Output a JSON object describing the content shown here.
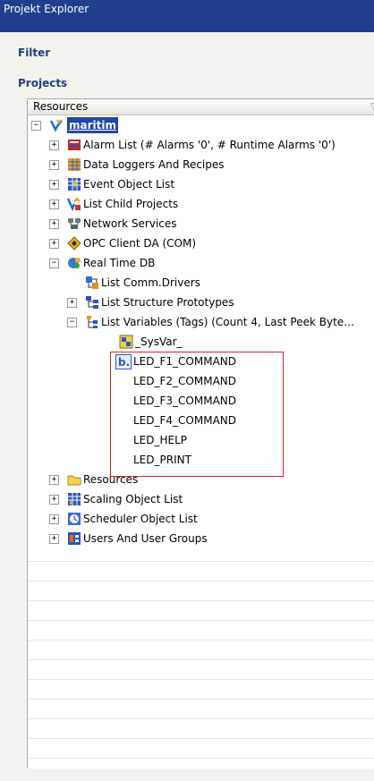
{
  "window": {
    "title": "Projekt Explorer"
  },
  "sections": {
    "filter": "Filter",
    "projects": "Projects"
  },
  "tree": {
    "column_header": "Resources",
    "root": "maritim",
    "items": [
      {
        "label": "Alarm List (# Alarms '0', # Runtime Alarms '0')",
        "icon": "alarm-list-icon",
        "expander": "+"
      },
      {
        "label": "Data Loggers And Recipes",
        "icon": "data-loggers-icon",
        "expander": "+"
      },
      {
        "label": "Event Object List",
        "icon": "event-list-icon",
        "expander": "+"
      },
      {
        "label": "List Child Projects",
        "icon": "child-projects-icon",
        "expander": "+"
      },
      {
        "label": "Network Services",
        "icon": "network-icon",
        "expander": "+"
      },
      {
        "label": "OPC Client DA (COM)",
        "icon": "opc-icon",
        "expander": "+"
      },
      {
        "label": "Real Time DB",
        "icon": "realtime-db-icon",
        "expander": "−"
      },
      {
        "label": "List Comm.Drivers",
        "icon": "comm-drivers-icon"
      },
      {
        "label": "List Structure Prototypes",
        "icon": "structure-icon",
        "expander": "+"
      },
      {
        "label": "List Variables (Tags) (Count 4, Last Peek Byte…",
        "icon": "variables-icon",
        "expander": "−"
      },
      {
        "label": "_SysVar_",
        "icon": "sysvar-icon"
      },
      {
        "label": "LED_F1_COMMAND",
        "icon": "bit-variable-icon"
      },
      {
        "label": "LED_F2_COMMAND"
      },
      {
        "label": "LED_F3_COMMAND"
      },
      {
        "label": "LED_F4_COMMAND"
      },
      {
        "label": "LED_HELP"
      },
      {
        "label": "LED_PRINT"
      },
      {
        "label": "Resources",
        "icon": "folder-icon",
        "expander": "+"
      },
      {
        "label": "Scaling Object List",
        "icon": "scaling-icon",
        "expander": "+"
      },
      {
        "label": "Scheduler Object List",
        "icon": "scheduler-icon",
        "expander": "+"
      },
      {
        "label": "Users And User Groups",
        "icon": "users-icon",
        "expander": "+"
      }
    ]
  },
  "colors": {
    "titlebar": "#1f3f8c",
    "section_text": "#213f7d",
    "selection": "#2146a6",
    "highlight_box": "#e02020"
  }
}
